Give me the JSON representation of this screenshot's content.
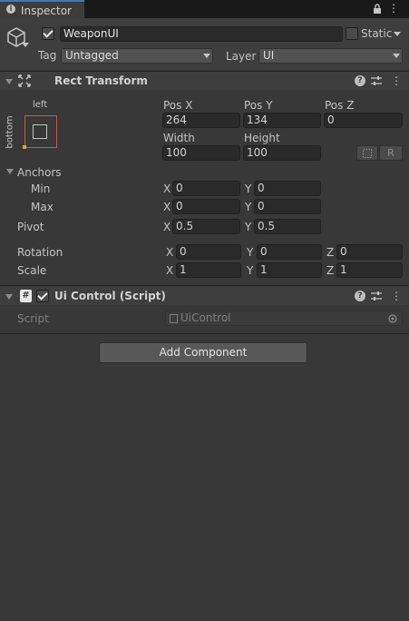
{
  "window": {
    "tab_label": "Inspector"
  },
  "object": {
    "name": "WeaponUI",
    "active": true,
    "static_label": "Static",
    "tag_label": "Tag",
    "tag_value": "Untagged",
    "layer_label": "Layer",
    "layer_value": "UI"
  },
  "rect_transform": {
    "title": "Rect Transform",
    "anchor_preset_top": "left",
    "anchor_preset_side": "bottom",
    "pos_x_label": "Pos X",
    "pos_x": "264",
    "pos_y_label": "Pos Y",
    "pos_y": "134",
    "pos_z_label": "Pos Z",
    "pos_z": "0",
    "width_label": "Width",
    "width": "100",
    "height_label": "Height",
    "height": "100",
    "raw_edit_label": "R",
    "anchors_label": "Anchors",
    "min_label": "Min",
    "min_x": "0",
    "min_y": "0",
    "max_label": "Max",
    "max_x": "0",
    "max_y": "0",
    "pivot_label": "Pivot",
    "pivot_x": "0.5",
    "pivot_y": "0.5",
    "rotation_label": "Rotation",
    "rot_x": "0",
    "rot_y": "0",
    "rot_z": "0",
    "scale_label": "Scale",
    "scale_x": "1",
    "scale_y": "1",
    "scale_z": "1",
    "x": "X",
    "y": "Y",
    "z": "Z"
  },
  "ui_control": {
    "title": "Ui Control (Script)",
    "enabled": true,
    "script_label": "Script",
    "script_value": "UiControl"
  },
  "add_component_label": "Add Component",
  "colors": {
    "accent": "#3a79bb",
    "background": "#383838",
    "header": "#3e3e3e"
  }
}
